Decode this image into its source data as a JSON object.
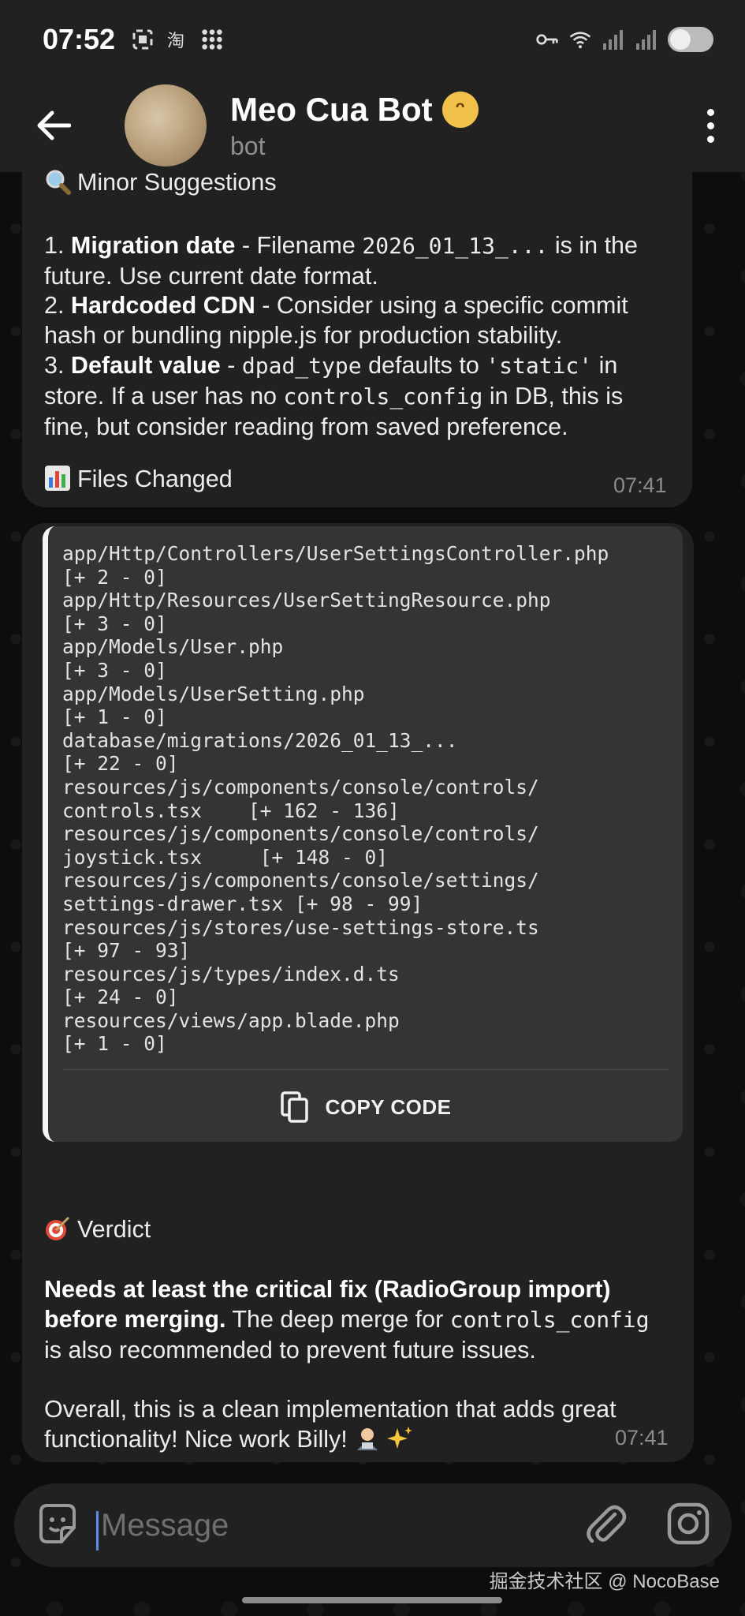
{
  "status_bar": {
    "time": "07:52",
    "left_icons": [
      "screenshot-icon",
      "taobao-icon",
      "apps-grid-icon"
    ],
    "right_icons": [
      "key-icon",
      "wifi-icon",
      "signal-icon",
      "signal-icon-2",
      "battery-toggle"
    ]
  },
  "header": {
    "bot_name": "Meo Cua Bot",
    "subtitle": "bot"
  },
  "message1": {
    "section_title": "Minor Suggestions",
    "items": [
      {
        "num": "1.",
        "bold": "Migration date",
        "pre": " - Filename ",
        "code": "2026_01_13_...",
        "post": " is in the",
        "line2": "future. Use current date format."
      },
      {
        "num": "2.",
        "bold": "Hardcoded CDN",
        "line1": " - Consider using a specific commit",
        "line2": "hash or bundling nipple.js for production stability."
      },
      {
        "num": "3.",
        "bold": "Default value",
        "pre": " - ",
        "code1": "dpad_type",
        "mid": " defaults to ",
        "code2": "'static'",
        "post": " in",
        "line2_pre": "store. If a user has no ",
        "code3": "controls_config",
        "line2_post": " in DB, this is",
        "line3": "fine, but consider reading from saved preference."
      }
    ],
    "files_title": "Files Changed",
    "timestamp": "07:41"
  },
  "message2": {
    "code_lines": [
      "app/Http/Controllers/UserSettingsController.php",
      "[+ 2 - 0]",
      "app/Http/Resources/UserSettingResource.php",
      "[+ 3 - 0]",
      "app/Models/User.php",
      "[+ 3 - 0]",
      "app/Models/UserSetting.php",
      "[+ 1 - 0]",
      "database/migrations/2026_01_13_...",
      "[+ 22 - 0]",
      "resources/js/components/console/controls/",
      "controls.tsx    [+ 162 - 136]",
      "resources/js/components/console/controls/",
      "joystick.tsx     [+ 148 - 0]",
      "resources/js/components/console/settings/",
      "settings-drawer.tsx [+ 98 - 99]",
      "resources/js/stores/use-settings-store.ts",
      "[+ 97 - 93]",
      "resources/js/types/index.d.ts",
      "[+ 24 - 0]",
      "resources/views/app.blade.php",
      "[+ 1 - 0]"
    ],
    "copy_label": "COPY CODE",
    "verdict_title": "Verdict",
    "verdict_bold1": "Needs at least the critical fix (RadioGroup import)",
    "verdict_bold2": "before merging.",
    "verdict_rest": " The deep merge for ",
    "verdict_code": "controls_config",
    "verdict_line3": "is also recommended to prevent future issues.",
    "closing_line1": "Overall, this is a clean implementation that adds great",
    "closing_line2": "functionality! Nice work Billy!",
    "timestamp": "07:41"
  },
  "input": {
    "placeholder": "Message"
  },
  "watermark": "掘金技术社区 @ NocoBase"
}
